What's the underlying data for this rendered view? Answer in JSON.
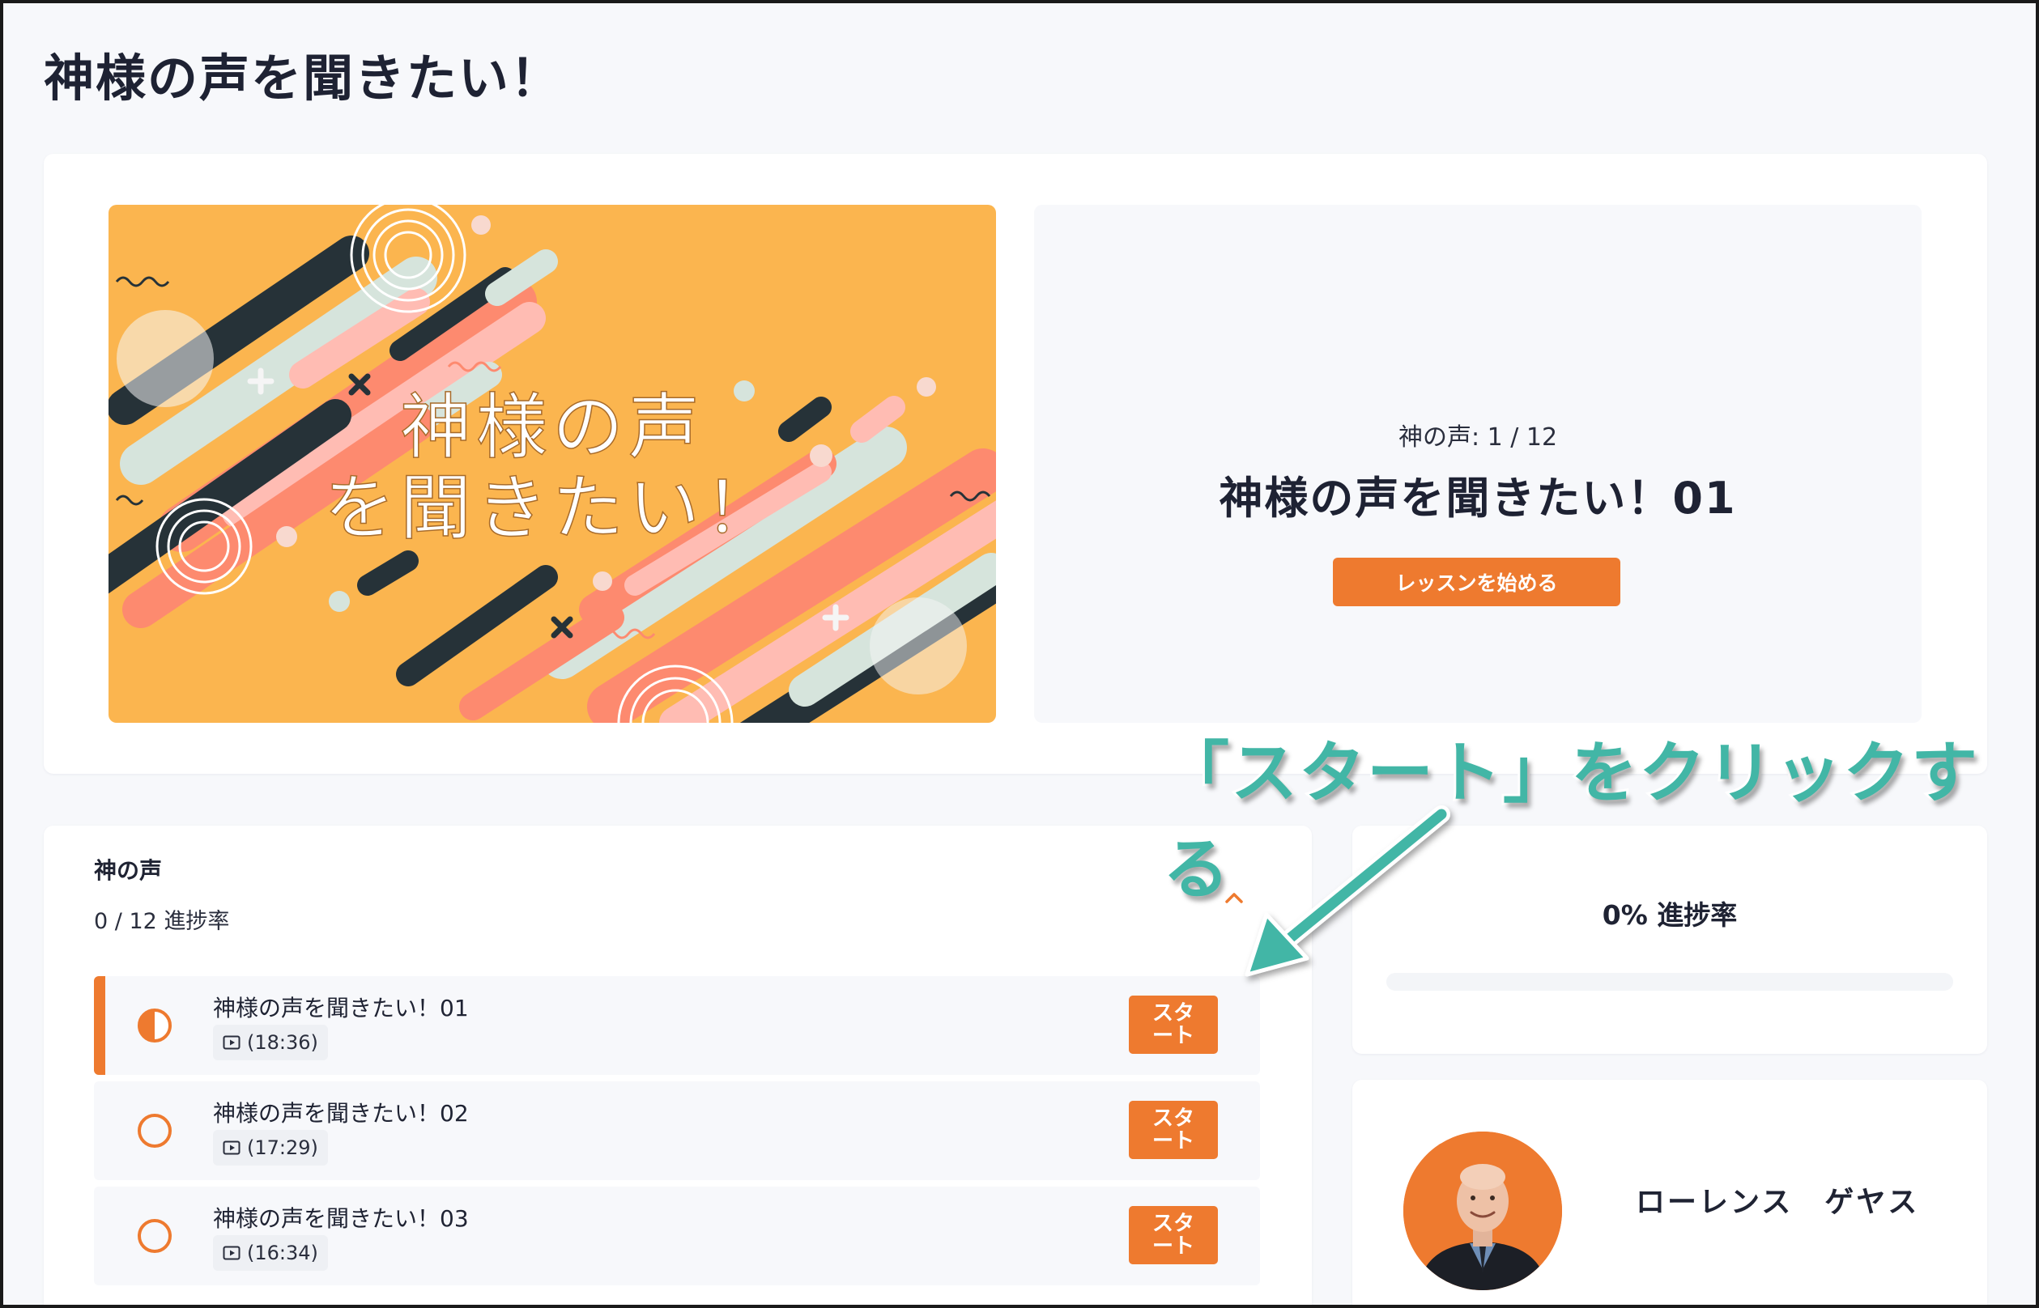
{
  "page": {
    "title": "神様の声を聞きたい！"
  },
  "hero": {
    "image_text_line1": "神様の声",
    "image_text_line2": "を聞きたい！",
    "lesson_count": "神の声: 1 / 12",
    "lesson_title": "神様の声を聞きたい！01",
    "start_button": "レッスンを始める"
  },
  "section": {
    "title": "神の声",
    "progress": "0 / 12 進捗率",
    "toggle_icon": "chevron-up-icon",
    "lessons": [
      {
        "title": "神様の声を聞きたい！01",
        "duration": "(18:36)",
        "status": "in-progress",
        "button": "スタート"
      },
      {
        "title": "神様の声を聞きたい！02",
        "duration": "(17:29)",
        "status": "not-started",
        "button": "スタート"
      },
      {
        "title": "神様の声を聞きたい！03",
        "duration": "(16:34)",
        "status": "not-started",
        "button": "スタート"
      }
    ]
  },
  "progress": {
    "label": "0% 進捗率",
    "percent": 0
  },
  "instructor": {
    "name": "ローレンス　ゲヤス"
  },
  "annotation": {
    "text": "「スタート」をクリックする"
  },
  "colors": {
    "accent": "#ee7a2f",
    "annotation": "#42b6a6",
    "hero_bg": "#fbb54f",
    "text": "#1f2333"
  }
}
